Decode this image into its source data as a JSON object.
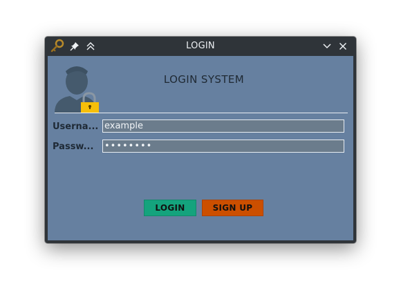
{
  "window": {
    "title": "LOGIN"
  },
  "icons": {
    "app": "key-icon",
    "pin": "pin-icon",
    "shade": "double-chevron-up-icon",
    "minimize": "chevron-down-icon",
    "close": "close-icon",
    "avatar": "user-lock-icon"
  },
  "header": {
    "title": "LOGIN SYSTEM"
  },
  "form": {
    "username_label": "Userna...",
    "username_value": "example",
    "password_label": "Passw...",
    "password_value": "••••••••"
  },
  "buttons": {
    "login": "LOGIN",
    "signup": "SIGN UP"
  },
  "colors": {
    "panel_bg": "#6680a0",
    "login_button": "#14a37d",
    "signup_button": "#cc4f00",
    "lock": "#f6bf0a"
  }
}
